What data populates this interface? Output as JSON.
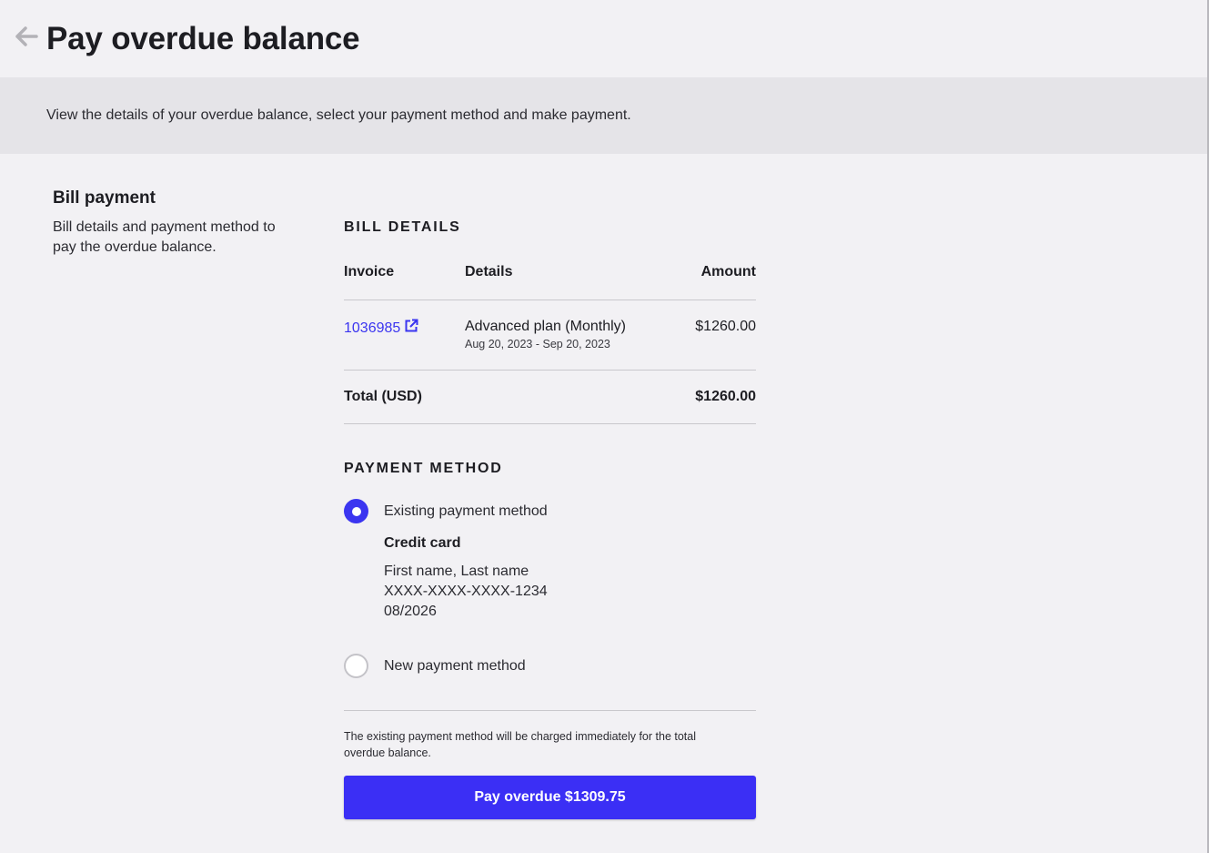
{
  "header": {
    "title": "Pay overdue balance",
    "back_icon": "arrow-left-icon"
  },
  "banner": {
    "text": "View the details of your overdue balance, select your payment method and make payment."
  },
  "left": {
    "title": "Bill payment",
    "description": "Bill details and payment method to pay the overdue balance."
  },
  "bill_details": {
    "heading": "BILL DETAILS",
    "columns": [
      "Invoice",
      "Details",
      "Amount"
    ],
    "rows": [
      {
        "invoice": "1036985",
        "details": "Advanced plan (Monthly)",
        "period": "Aug 20, 2023 - Sep 20, 2023",
        "amount": "$1260.00"
      }
    ],
    "total_label": "Total (USD)",
    "total_amount": "$1260.00"
  },
  "payment_method": {
    "heading": "PAYMENT METHOD",
    "existing_label": "Existing payment method",
    "existing_selected": true,
    "card_title": "Credit card",
    "card_name": "First name, Last name",
    "card_number": "XXXX-XXXX-XXXX-1234",
    "card_expiry": "08/2026",
    "new_label": "New payment method",
    "new_selected": false
  },
  "note": "The existing payment method will be charged immediately for the total overdue balance.",
  "pay_button": "Pay overdue $1309.75",
  "colors": {
    "accent": "#3b35f0",
    "button": "#3b2ff5",
    "banner_bg": "#e5e4e8",
    "page_bg": "#f2f1f4"
  }
}
